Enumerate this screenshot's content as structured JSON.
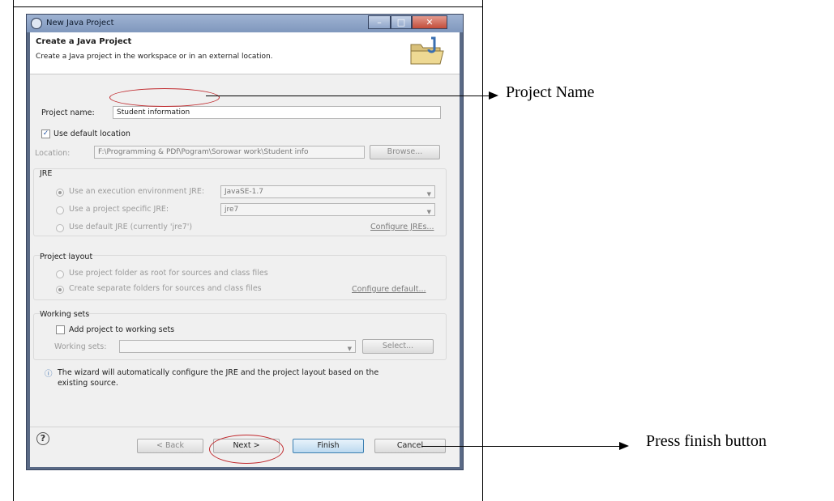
{
  "window": {
    "title": "New Java Project",
    "buttons": {
      "minimize": "–",
      "maximize": "□",
      "close": "✕"
    }
  },
  "banner": {
    "title": "Create a Java Project",
    "description": "Create a Java project in the workspace or in an external location."
  },
  "project_name": {
    "label": "Project name:",
    "value": "Student information"
  },
  "default_location": {
    "label": "Use default location",
    "checked": true
  },
  "location": {
    "label": "Location:",
    "value": "F:\\Programming & PDf\\Pogram\\Sorowar work\\Student info",
    "browse": "Browse..."
  },
  "jre": {
    "title": "JRE",
    "exec_env_label": "Use an execution environment JRE:",
    "exec_env_value": "JavaSE-1.7",
    "project_specific_label": "Use a project specific JRE:",
    "project_specific_value": "jre7",
    "default_label": "Use default JRE (currently 'jre7')",
    "configure_link": "Configure JREs..."
  },
  "layout": {
    "title": "Project layout",
    "option_root": "Use project folder as root for sources and class files",
    "option_separate": "Create separate folders for sources and class files",
    "configure_link": "Configure default..."
  },
  "working_sets": {
    "title": "Working sets",
    "add_label": "Add project to working sets",
    "field_label": "Working sets:",
    "select": "Select..."
  },
  "info": {
    "line1": "The wizard will automatically configure the JRE and the project layout based on the",
    "line2": "existing source."
  },
  "footer": {
    "help": "?",
    "back": "< Back",
    "next": "Next >",
    "finish": "Finish",
    "cancel": "Cancel"
  },
  "annotations": {
    "project_name": "Project Name",
    "finish": "Press finish button"
  }
}
